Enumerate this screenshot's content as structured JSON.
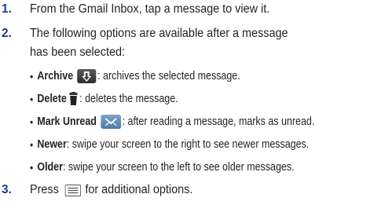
{
  "steps": [
    {
      "number": "1.",
      "text": "From the Gmail Inbox, tap a message to view it."
    },
    {
      "number": "2.",
      "text": "The following options are available after a message",
      "continuation": "has been selected:",
      "bullets": [
        {
          "bullet": "•",
          "term": "Archive",
          "icon": "archive-icon",
          "separator": ":",
          "description": " archives the selected message."
        },
        {
          "bullet": "•",
          "term": "Delete",
          "icon": "trash-icon",
          "separator": ":",
          "description": " deletes the message."
        },
        {
          "bullet": "•",
          "term": "Mark Unread",
          "icon": "mark-unread-envelope-icon",
          "separator": ":",
          "description": " after reading a message, marks as unread."
        },
        {
          "bullet": "•",
          "term": "Newer",
          "separator": ":",
          "description": " swipe your screen to the right to see newer messages."
        },
        {
          "bullet": "•",
          "term": "Older",
          "separator": ":",
          "description": " swipe your screen to the left to see older messages."
        }
      ]
    },
    {
      "number": "3.",
      "text_before": "Press",
      "icon": "menu-icon",
      "text_after": "for additional options."
    }
  ],
  "colors": {
    "step_number": "#1b3f8f",
    "text": "#231f20",
    "archive_icon_bg": "#3c3c3c",
    "unread_icon_bg": "#5f86b0"
  }
}
